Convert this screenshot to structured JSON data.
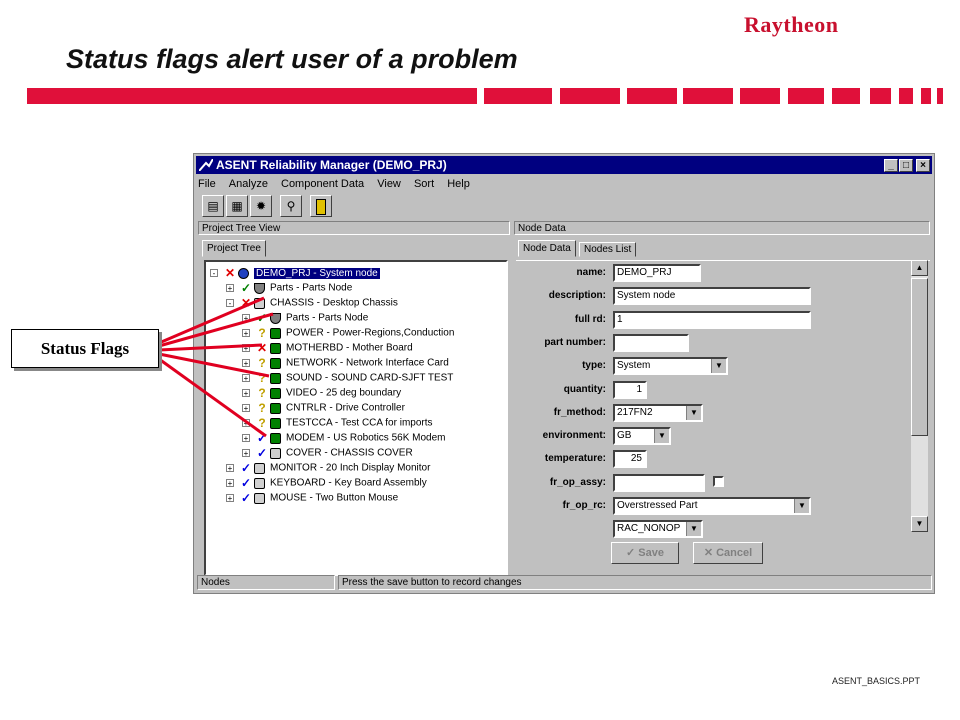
{
  "slide": {
    "brand": "Raytheon",
    "title": "Status flags alert user of a problem",
    "footer": "ASENT_BASICS.PPT",
    "callout": "Status Flags"
  },
  "window": {
    "title": "ASENT Reliability Manager (DEMO_PRJ)",
    "controls": [
      "_",
      "□",
      "×"
    ],
    "menu": [
      "File",
      "Analyze",
      "Component Data",
      "View",
      "Sort",
      "Help"
    ],
    "toolbar_icons": [
      "reports-icon",
      "calculator-icon",
      "settings-gear-icon",
      "find-icon",
      "exit-door-icon"
    ]
  },
  "left_panel": {
    "header": "Project Tree View",
    "tab": "Project Tree",
    "tree": [
      {
        "expander": "-",
        "status": "x",
        "icon": "system",
        "text": "DEMO_PRJ  -  System node",
        "selected": true
      },
      {
        "expander": "+",
        "status": "check",
        "icon": "parts",
        "text": "Parts  -  Parts Node"
      },
      {
        "expander": "-",
        "status": "x",
        "icon": "assembly",
        "text": "CHASSIS  -  Desktop Chassis"
      },
      {
        "expander": "+",
        "status": "check",
        "icon": "parts",
        "text": "Parts  -  Parts Node"
      },
      {
        "expander": "+",
        "status": "?",
        "icon": "cca",
        "text": "POWER  -  Power-Regions,Conduction"
      },
      {
        "expander": "+",
        "status": "x",
        "icon": "cca",
        "text": "MOTHERBD  -  Mother Board"
      },
      {
        "expander": "+",
        "status": "?",
        "icon": "cca",
        "text": "NETWORK  -  Network Interface Card"
      },
      {
        "expander": "+",
        "status": "?",
        "icon": "cca",
        "text": "SOUND  -  SOUND CARD-SJFT TEST"
      },
      {
        "expander": "+",
        "status": "?",
        "icon": "cca",
        "text": "VIDEO  -  25 deg boundary"
      },
      {
        "expander": "+",
        "status": "?",
        "icon": "cca",
        "text": "CNTRLR  -  Drive Controller"
      },
      {
        "expander": "+",
        "status": "?",
        "icon": "cca",
        "text": "TESTCCA  -  Test CCA for imports"
      },
      {
        "expander": "+",
        "status": "check-blue",
        "icon": "cca",
        "text": "MODEM  -  US Robotics 56K Modem"
      },
      {
        "expander": "+",
        "status": "check-blue",
        "icon": "assembly",
        "text": "COVER  -  CHASSIS COVER"
      },
      {
        "expander": "+",
        "status": "check-blue",
        "icon": "assembly",
        "text": "MONITOR  -  20 Inch Display Monitor"
      },
      {
        "expander": "+",
        "status": "check-blue",
        "icon": "assembly",
        "text": "KEYBOARD  -  Key Board Assembly"
      },
      {
        "expander": "+",
        "status": "check-blue",
        "icon": "assembly",
        "text": "MOUSE  -  Two Button Mouse"
      }
    ]
  },
  "right_panel": {
    "header": "Node Data",
    "tabs": [
      "Node Data",
      "Nodes List"
    ],
    "fields": [
      {
        "label": "name:",
        "value": "DEMO_PRJ",
        "kind": "text"
      },
      {
        "label": "description:",
        "value": "System node",
        "kind": "text"
      },
      {
        "label": "full rd:",
        "value": "1",
        "kind": "text"
      },
      {
        "label": "part number:",
        "value": "",
        "kind": "text"
      },
      {
        "label": "type:",
        "value": "System",
        "kind": "select"
      },
      {
        "label": "quantity:",
        "value": "1",
        "kind": "number"
      },
      {
        "label": "fr_method:",
        "value": "217FN2",
        "kind": "select"
      },
      {
        "label": "environment:",
        "value": "GB",
        "kind": "select"
      },
      {
        "label": "temperature:",
        "value": "25",
        "kind": "number"
      },
      {
        "label": "fr_op_assy:",
        "value": "",
        "kind": "text-check"
      },
      {
        "label": "fr_op_rc:",
        "value": "Overstressed Part",
        "kind": "select"
      },
      {
        "label": "",
        "value": "RAC_NONOP",
        "kind": "select"
      }
    ],
    "buttons": {
      "save": "Save",
      "cancel": "Cancel"
    }
  },
  "statusbar": {
    "left": "Nodes",
    "right": "Press the save button to record changes"
  },
  "colors": {
    "accent_red": "#e0103a",
    "titlebar": "#000080",
    "brand_red": "#c8102e",
    "x_red": "#e00000",
    "check_green": "#008000",
    "check_blue": "#0000e0",
    "question": "#c0a000"
  }
}
